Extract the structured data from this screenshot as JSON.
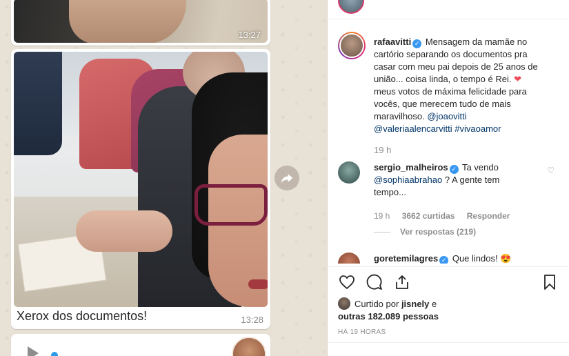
{
  "chat": {
    "top_photo_time": "13:27",
    "main_caption": "Xerox dos documentos!",
    "main_time": "13:28"
  },
  "post": {
    "username": "rafaavitti",
    "caption_text": "Mensagem da mamãe no cartório separando os documentos pra casar com meu pai depois de 25 anos de união... coisa linda, o tempo é Rei.",
    "heart": "❤",
    "caption_text_2": "meus votos de máxima felicidade para vocês, que merecem tudo de mais maravilhoso.",
    "mention_1": "@joaovitti",
    "mention_2": "@valeriaalencarvitti",
    "hashtag": "#vivaoamor",
    "time": "19 h"
  },
  "comments": [
    {
      "username": "sergio_malheiros",
      "mention": "@sophiaabrahao",
      "text_before": "Ta vendo",
      "text_after": "? A gente tem tempo...",
      "time": "19 h",
      "likes": "3662 curtidas",
      "reply_label": "Responder",
      "view_replies": "Ver respostas (219)"
    },
    {
      "username": "goretemilagres",
      "text": "Que lindos!",
      "emoji": "😍"
    }
  ],
  "likes": {
    "prefix": "Curtido por",
    "user": "jisnely",
    "connector": "e",
    "others": "outras 182.089 pessoas"
  },
  "posted_ago": "HÁ 19 HORAS",
  "icons": [
    "heart-icon",
    "comment-icon",
    "share-icon",
    "bookmark-icon",
    "forward-icon",
    "play-icon"
  ],
  "colors": {
    "link": "#003569",
    "verified": "#3897f0",
    "heart_red": "#ed4956",
    "chat_bg": "#e8e1d6"
  }
}
